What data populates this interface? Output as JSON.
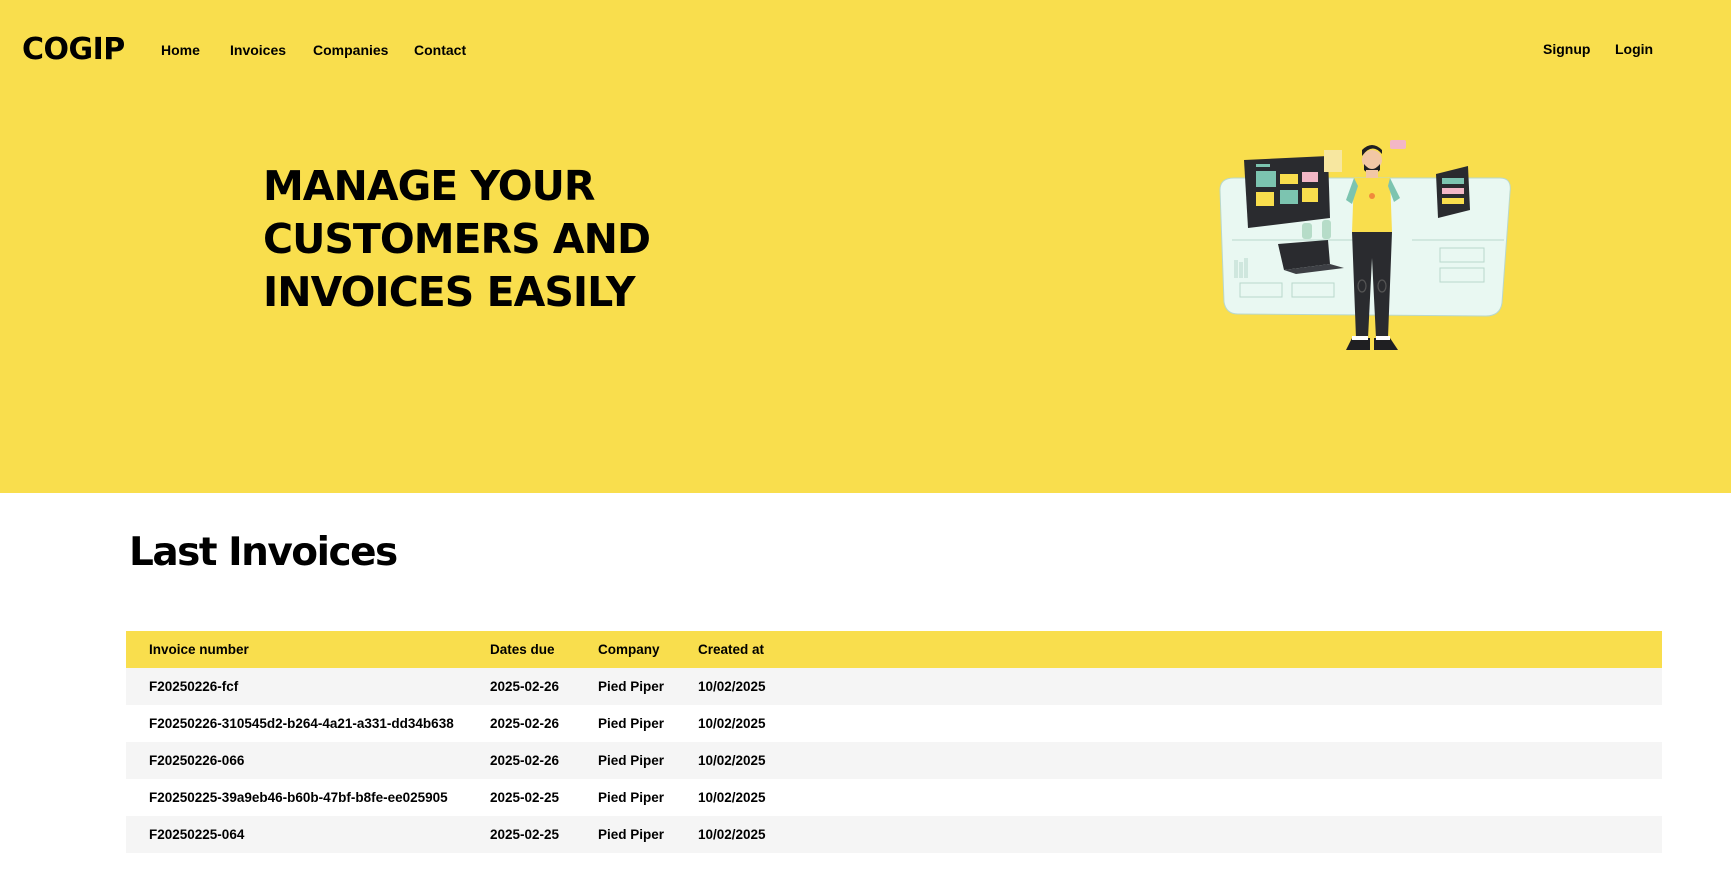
{
  "header": {
    "logo": "COGIP",
    "nav": [
      "Home",
      "Invoices",
      "Companies",
      "Contact"
    ],
    "auth": [
      "Signup",
      "Login"
    ]
  },
  "hero": {
    "title": "MANAGE YOUR CUSTOMERS AND INVOICES EASILY",
    "illustration": "person-with-dashboard-screens-illustration"
  },
  "invoices": {
    "title": "Last Invoices",
    "columns": [
      "Invoice number",
      "Dates due",
      "Company",
      "Created at"
    ],
    "rows": [
      [
        "F20250226-fcf",
        "2025-02-26",
        "Pied Piper",
        "10/02/2025"
      ],
      [
        "F20250226-310545d2-b264-4a21-a331-dd34b638",
        "2025-02-26",
        "Pied Piper",
        "10/02/2025"
      ],
      [
        "F20250226-066",
        "2025-02-26",
        "Pied Piper",
        "10/02/2025"
      ],
      [
        "F20250225-39a9eb46-b60b-47bf-b8fe-ee025905",
        "2025-02-25",
        "Pied Piper",
        "10/02/2025"
      ],
      [
        "F20250225-064",
        "2025-02-25",
        "Pied Piper",
        "10/02/2025"
      ]
    ]
  },
  "colors": {
    "brand_yellow": "#f9de4d",
    "row_alt": "#f5f5f5",
    "text": "#000000"
  }
}
